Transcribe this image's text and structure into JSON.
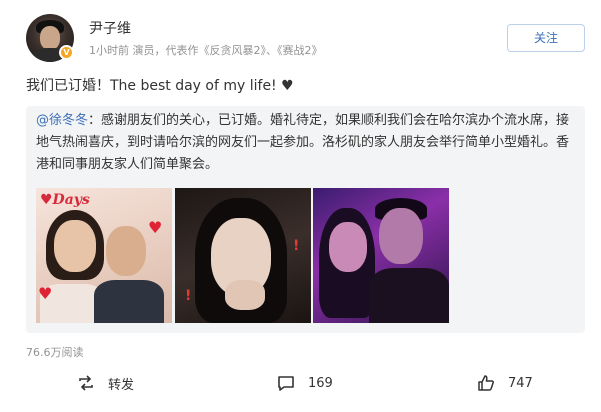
{
  "user": {
    "name": "尹子维",
    "meta": "1小时前  演员，代表作《反贪风暴2》、《赛战2》",
    "verified_badge": "V"
  },
  "follow_label": "关注",
  "post_text": "我们已订婚！The best day of my life! ♥",
  "repost": {
    "mention": "@徐冬冬",
    "text": "：感谢朋友们的关心，已订婚。婚礼待定，如果顺利我们会在哈尔滨办个流水席，接地气热闹喜庆，到时请哈尔滨的网友们一起参加。洛杉矶的家人朋友会举行简单小型婚礼。香港和同事朋友家人们简单聚会。",
    "image1_caption": "♥Days"
  },
  "views": "76.6万阅读",
  "actions": {
    "repost_label": "转发",
    "comment_count": "169",
    "like_count": "747"
  },
  "icons": [
    "repost-icon",
    "comment-icon",
    "like-icon",
    "verified-badge-icon"
  ],
  "colors": {
    "link": "#3b6fb6",
    "badge": "#f5a623",
    "muted": "#939393"
  }
}
